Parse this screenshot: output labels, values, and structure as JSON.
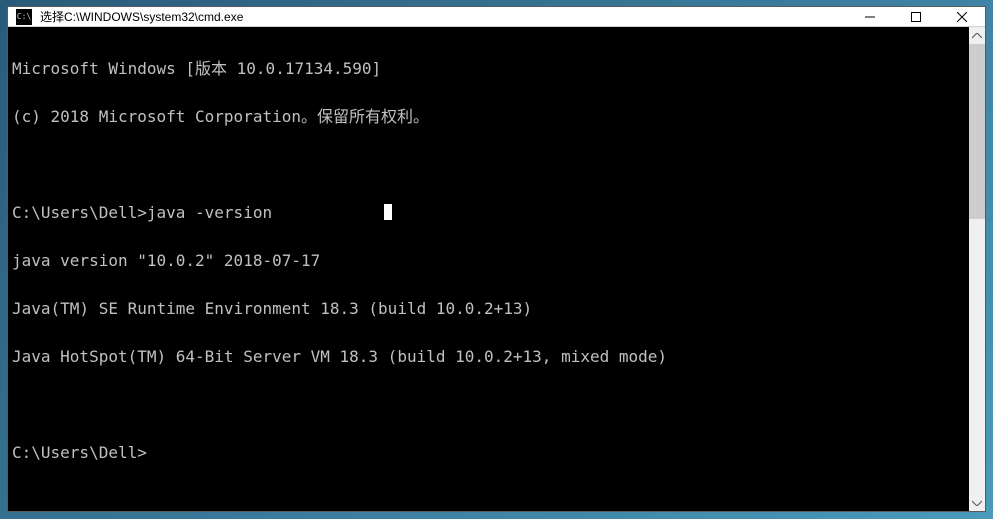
{
  "titlebar": {
    "icon_label": "C:\\",
    "title": "选择C:\\WINDOWS\\system32\\cmd.exe"
  },
  "console": {
    "lines": [
      "Microsoft Windows [版本 10.0.17134.590]",
      "(c) 2018 Microsoft Corporation。保留所有权利。",
      "",
      "C:\\Users\\Dell>java -version",
      "java version \"10.0.2\" 2018-07-17",
      "Java(TM) SE Runtime Environment 18.3 (build 10.0.2+13)",
      "Java HotSpot(TM) 64-Bit Server VM 18.3 (build 10.0.2+13, mixed mode)",
      "",
      "C:\\Users\\Dell>"
    ]
  }
}
